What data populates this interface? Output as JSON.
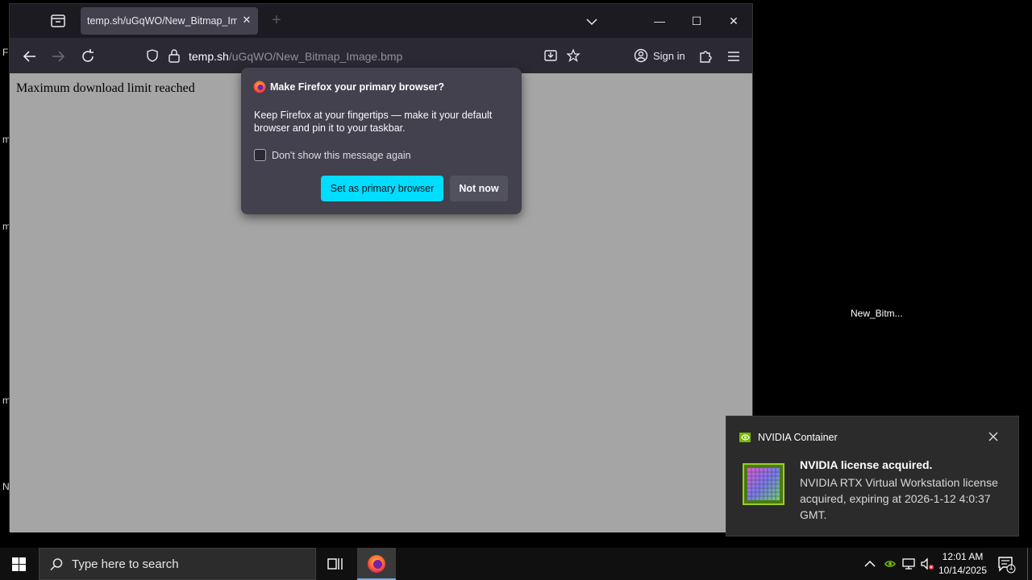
{
  "desktop": {
    "icon_label": "New_Bitm...",
    "edge_letters": [
      "F",
      "m",
      "m",
      "m",
      "N"
    ]
  },
  "browser": {
    "tab": {
      "title": "temp.sh/uGqWO/New_Bitmap_Image.bmp",
      "close": "✕"
    },
    "new_tab": "+",
    "window": {
      "minimize": "—",
      "maximize": "☐",
      "close": "✕"
    },
    "url": {
      "host": "temp.sh",
      "path": "/uGqWO/New_Bitmap_Image.bmp"
    },
    "sign_in": "Sign in",
    "content_message": "Maximum download limit reached"
  },
  "popup": {
    "title": "Make Firefox your primary browser?",
    "body": "Keep Firefox at your fingertips — make it your default browser and pin it to your taskbar.",
    "checkbox_label": "Don't show this message again",
    "primary_button": "Set as primary browser",
    "secondary_button": "Not now"
  },
  "notification": {
    "app_name": "NVIDIA Container",
    "title": "NVIDIA license acquired.",
    "body": "NVIDIA RTX Virtual Workstation license acquired, expiring at 2026-1-12 4:0:37 GMT."
  },
  "taskbar": {
    "search_placeholder": "Type here to search",
    "time": "12:01 AM",
    "date": "10/14/2025",
    "notification_count": "1"
  },
  "colors": {
    "accent": "#00ddff",
    "content_bg": "#a5a5a5",
    "nvidia_green": "#76b900"
  }
}
